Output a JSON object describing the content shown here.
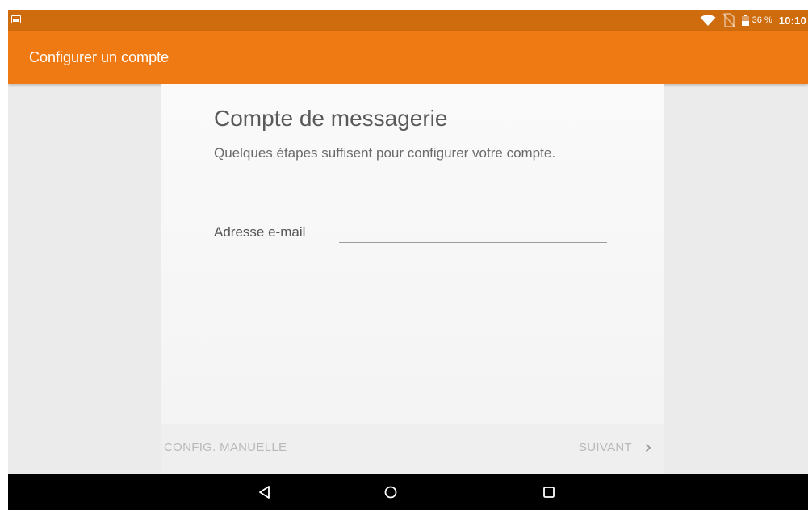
{
  "status_bar": {
    "battery_percent": "36 %",
    "time": "10:10",
    "icons": [
      "image-notification-icon",
      "wifi-icon",
      "no-sim-icon",
      "battery-icon"
    ]
  },
  "app_bar": {
    "title": "Configurer un compte"
  },
  "card": {
    "title": "Compte de messagerie",
    "subtitle": "Quelques étapes suffisent pour configurer votre compte.",
    "email_label": "Adresse e-mail",
    "email_value": ""
  },
  "footer": {
    "manual_label": "CONFIG. MANUELLE",
    "next_label": "SUIVANT"
  },
  "nav": {
    "icons": [
      "back-icon",
      "home-icon",
      "recents-icon"
    ]
  },
  "colors": {
    "status_bar": "#cf6c0e",
    "app_bar": "#ef7a14",
    "background": "#ebebeb",
    "card": "#f7f7f7",
    "disabled_text": "#b9b9b9"
  }
}
